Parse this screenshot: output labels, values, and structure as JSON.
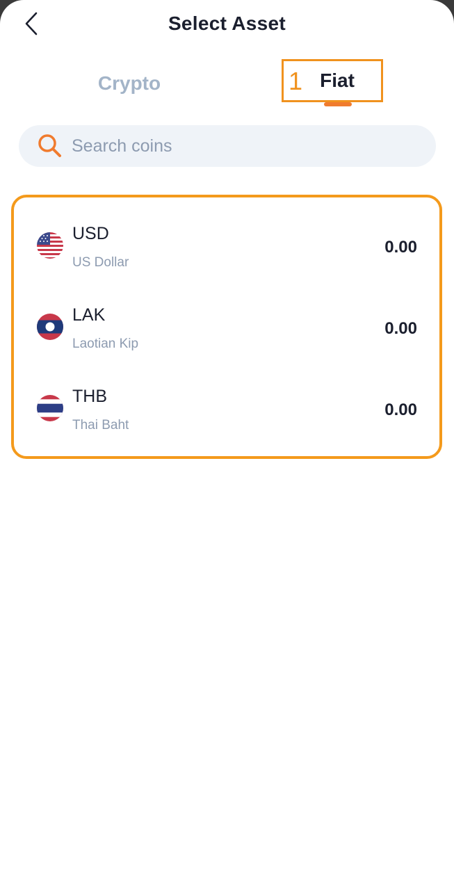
{
  "header": {
    "title": "Select Asset"
  },
  "tabs": {
    "crypto": "Crypto",
    "fiat": "Fiat",
    "active": "Fiat",
    "step_marker": "1"
  },
  "search": {
    "placeholder": "Search coins",
    "value": ""
  },
  "assets": [
    {
      "code": "USD",
      "name": "US Dollar",
      "balance": "0.00",
      "icon": "us-flag-icon"
    },
    {
      "code": "LAK",
      "name": "Laotian Kip",
      "balance": "0.00",
      "icon": "laos-flag-icon"
    },
    {
      "code": "THB",
      "name": "Thai Baht",
      "balance": "0.00",
      "icon": "thailand-flag-icon"
    }
  ],
  "colors": {
    "accent": "#f49a1c",
    "tab_indicator": "#f07b2e",
    "search_icon": "#f07b2e",
    "text_primary": "#1b1f2e",
    "text_secondary": "#8d9bb0",
    "tab_inactive": "#a3b4c8",
    "search_bg": "#eff3f8"
  }
}
